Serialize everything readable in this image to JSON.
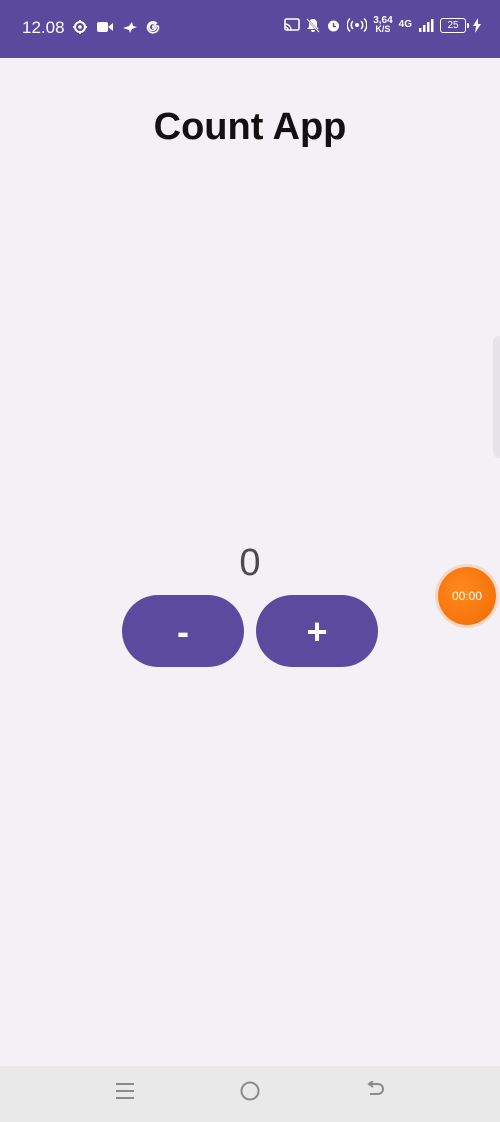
{
  "status_bar": {
    "time": "12.08",
    "net_speed_value": "3,64",
    "net_speed_unit": "K/S",
    "network": "4G",
    "battery": "25",
    "icons": [
      "settings-icon",
      "video-icon",
      "bird-icon",
      "google-icon",
      "cast-icon",
      "mute-icon",
      "alarm-icon",
      "hotspot-icon",
      "signal-icon",
      "battery-icon",
      "charging-icon"
    ],
    "background_color": "#5a4a9e"
  },
  "app": {
    "title": "Count App",
    "count": "0",
    "decrement_label": "-",
    "increment_label": "+",
    "accent_color": "#5b4b9f"
  },
  "overlay": {
    "timer": "00:00",
    "timer_color": "#f26a05"
  },
  "nav_bar": {
    "icons": [
      "menu-icon",
      "home-icon",
      "back-icon"
    ]
  }
}
